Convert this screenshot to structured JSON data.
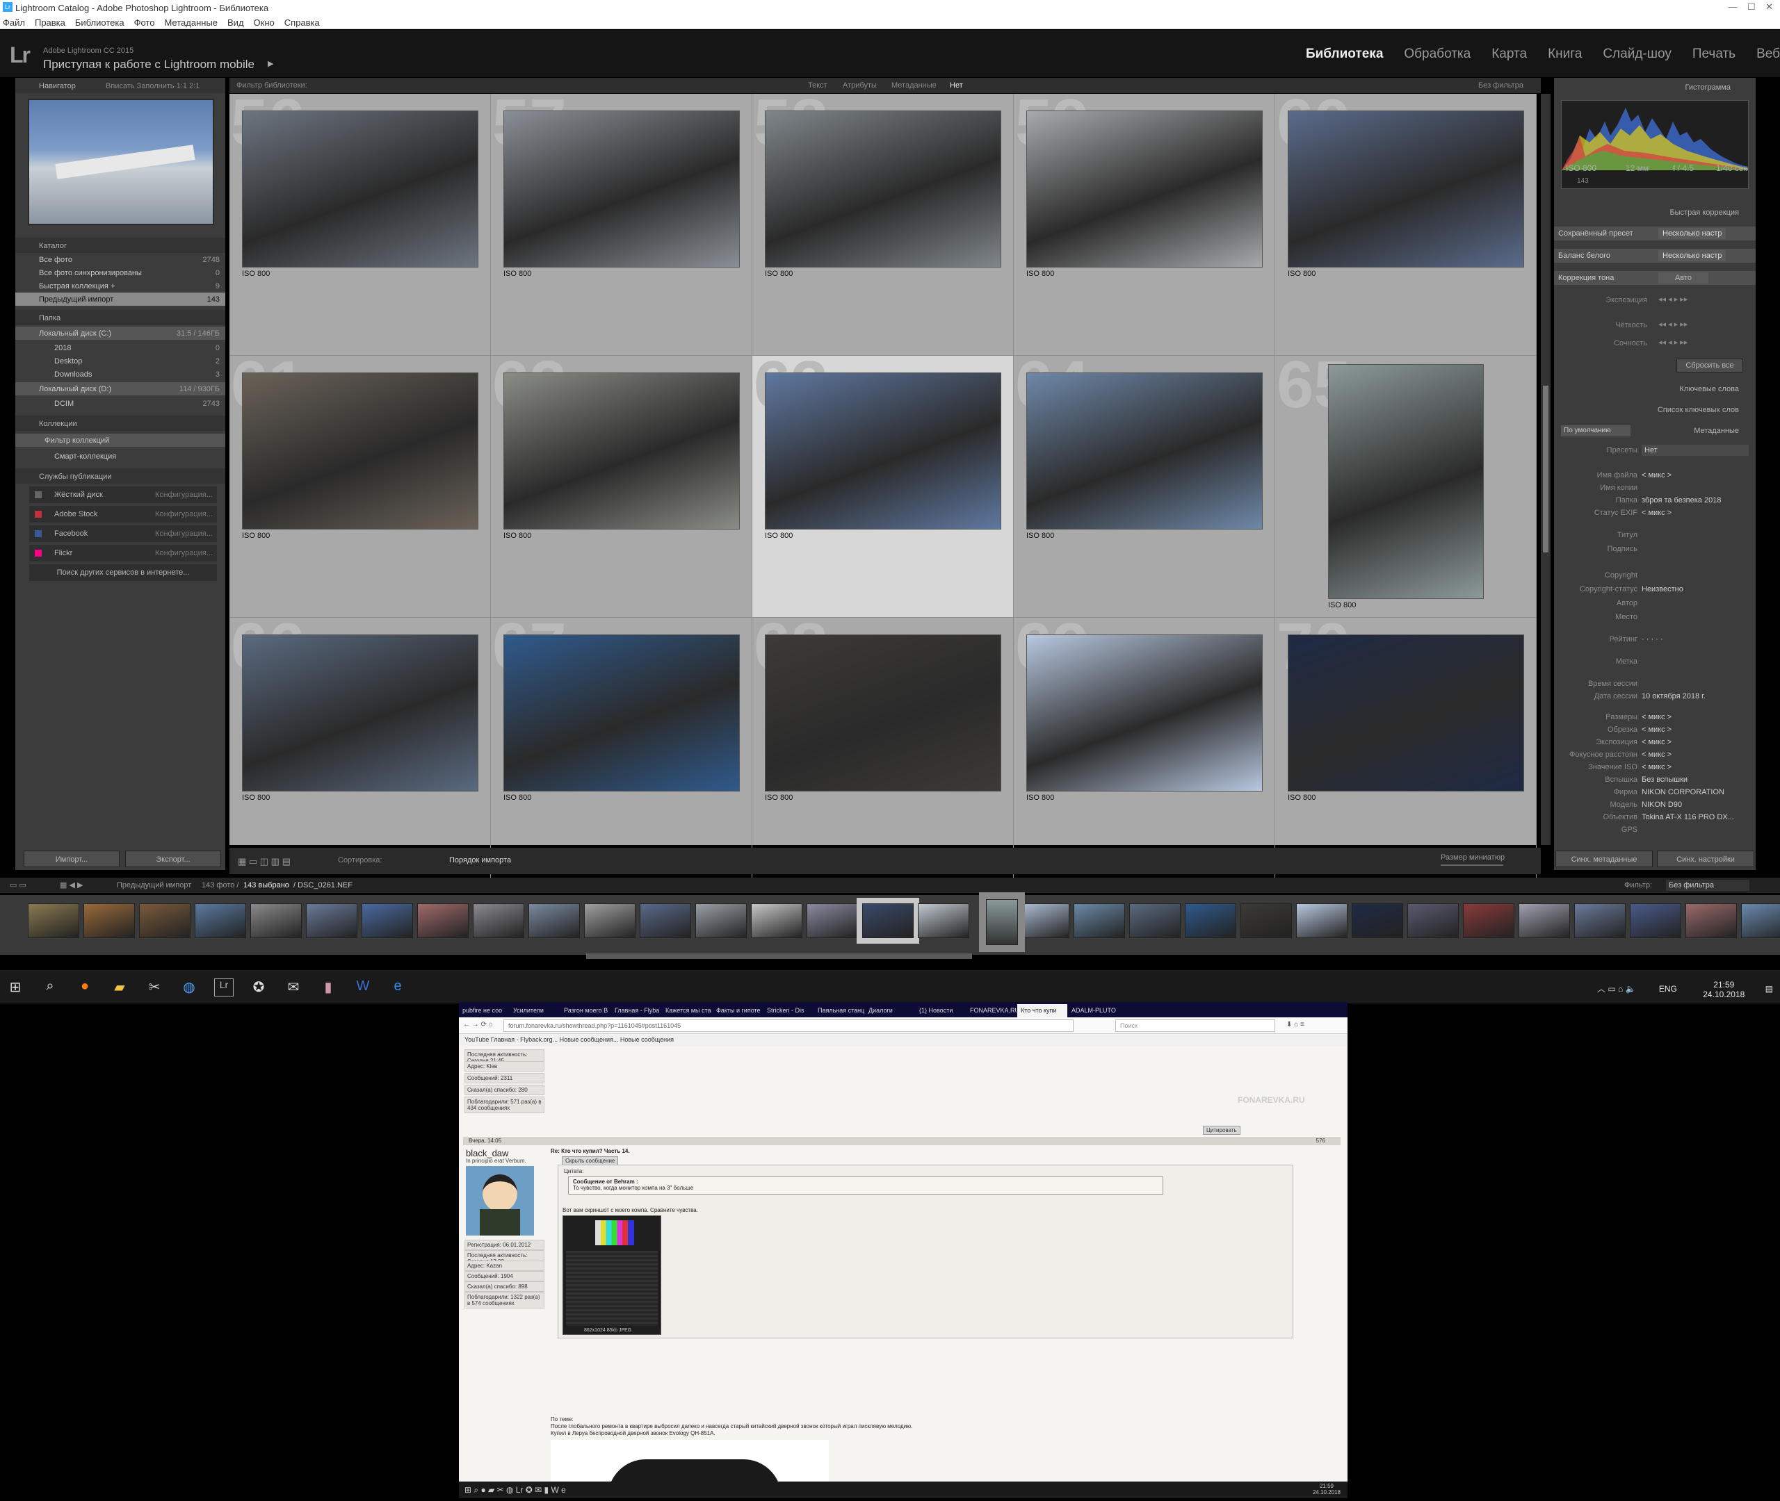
{
  "window": {
    "title": "Lightroom Catalog - Adobe Photoshop Lightroom - Библиотека"
  },
  "menu": [
    "Файл",
    "Правка",
    "Библиотека",
    "Фото",
    "Метаданные",
    "Вид",
    "Окно",
    "Справка"
  ],
  "identity": {
    "logo": "Lr",
    "version": "Adobe Lightroom CC 2015",
    "mobile": "Приступая к работе с Lightroom mobile"
  },
  "modules": [
    "Библиотека",
    "Обработка",
    "Карта",
    "Книга",
    "Слайд-шоу",
    "Печать",
    "Веб"
  ],
  "navigator": {
    "title": "Навигатор",
    "modes": "Вписать   Заполнить   1:1   2:1"
  },
  "catalog": {
    "title": "Каталог",
    "items": [
      {
        "label": "Все фото",
        "count": "2748"
      },
      {
        "label": "Все фото синхронизированы",
        "count": "0"
      },
      {
        "label": "Быстрая коллекция +",
        "count": "9"
      },
      {
        "label": "Предыдущий импорт",
        "count": "143"
      }
    ]
  },
  "folders": {
    "title": "Папка",
    "disk_c": "Локальный диск (C:)",
    "disk_c_size": "31.5 / 146ГБ",
    "items": [
      {
        "label": "2018",
        "count": "0"
      },
      {
        "label": "Desktop",
        "count": "2"
      },
      {
        "label": "Downloads",
        "count": "3"
      }
    ],
    "disk_d": "Локальный диск (D:)",
    "disk_d_size": "114 / 930ГБ",
    "dcim": "DCIM",
    "dcim_count": "2743"
  },
  "collections": {
    "title": "Коллекции",
    "filter": "Фильтр коллекций",
    "smart": "Смарт-коллекция"
  },
  "publish": {
    "title": "Службы публикации",
    "items": [
      {
        "label": "Жёсткий диск",
        "cfg": "Конфигурация..."
      },
      {
        "label": "Adobe Stock",
        "cfg": "Конфигурация..."
      },
      {
        "label": "Facebook",
        "cfg": "Конфигурация..."
      },
      {
        "label": "Flickr",
        "cfg": "Конфигурация..."
      }
    ],
    "more": "Поиск других сервисов в интернете..."
  },
  "buttons": {
    "import": "Импорт...",
    "export": "Экспорт...",
    "sync_meta": "Синх. метаданные",
    "sync_set": "Синх. настройки"
  },
  "filter_bar": {
    "label": "Фильтр библиотеки:",
    "text": "Текст",
    "attr": "Атрибуты",
    "meta": "Метаданные",
    "none": "Нет",
    "preset": "Без фильтра"
  },
  "grid": [
    {
      "num": "56",
      "iso": "ISO 800",
      "color": "#6d7580"
    },
    {
      "num": "57",
      "iso": "ISO 800",
      "color": "#8a8f96"
    },
    {
      "num": "58",
      "iso": "ISO 800",
      "color": "#7f868a"
    },
    {
      "num": "59",
      "iso": "ISO 800",
      "color": "#a7a9ab"
    },
    {
      "num": "60",
      "iso": "ISO 800",
      "color": "#5a6b8a"
    },
    {
      "num": "61",
      "iso": "ISO 800",
      "color": "#6a6258"
    },
    {
      "num": "62",
      "iso": "ISO 800",
      "color": "#8a8c86"
    },
    {
      "num": "63",
      "iso": "ISO 800",
      "color": "#5f78a0"
    },
    {
      "num": "64",
      "iso": "ISO 800",
      "color": "#6e88a8"
    },
    {
      "num": "65",
      "iso": "ISO 800",
      "color": "#8c9a98"
    },
    {
      "num": "66",
      "iso": "ISO 800",
      "color": "#5a6a80"
    },
    {
      "num": "67",
      "iso": "ISO 800",
      "color": "#2f5a8c"
    },
    {
      "num": "68",
      "iso": "ISO 800",
      "color": "#3c3a36"
    },
    {
      "num": "69",
      "iso": "ISO 800",
      "color": "#b8c8e0"
    },
    {
      "num": "70",
      "iso": "ISO 800",
      "color": "#1e2a44"
    }
  ],
  "toolbar": {
    "sort_label": "Сортировка:",
    "sort_value": "Порядок импорта",
    "thumb_size": "Размер миниатюр"
  },
  "filmstrip": {
    "source": "Предыдущий импорт",
    "count": "143 фото /",
    "selected": "143 выбрано",
    "file": "/ DSC_0261.NEF",
    "filter_label": "Фильтр:",
    "filter_value": "Без фильтра"
  },
  "histogram": {
    "title": "Гистограмма",
    "iso": "ISO 800",
    "focal": "12 мм",
    "aperture": "f / 4.5",
    "shutter": "1/40 сек",
    "count": "143"
  },
  "quick": {
    "title": "Быстрая коррекция",
    "preset_label": "Сохранённый пресет",
    "preset_value": "Несколько настр",
    "wb_label": "Баланс белого",
    "wb_value": "Несколько настр",
    "tone_label": "Коррекция тона",
    "tone_btn": "Авто",
    "exposure": "Экспозиция",
    "clarity": "Чёткость",
    "vibrance": "Сочность",
    "reset": "Сбросить все"
  },
  "keywords": {
    "title": "Ключевые слова",
    "list": "Список ключевых слов"
  },
  "metadata": {
    "title": "Метаданные",
    "mode": "По умолчанию",
    "preset_label": "Пресеты",
    "preset_value": "Нет",
    "fields": [
      {
        "k": "Имя файла",
        "v": "< микс >"
      },
      {
        "k": "Имя копии",
        "v": ""
      },
      {
        "k": "Папка",
        "v": "зброя та безпека 2018"
      },
      {
        "k": "Статус EXIF",
        "v": "< микс >"
      },
      {
        "k": "Титул",
        "v": ""
      },
      {
        "k": "Подпись",
        "v": ""
      },
      {
        "k": "Copyright",
        "v": ""
      },
      {
        "k": "Copyright-статус",
        "v": "Неизвестно"
      },
      {
        "k": "Автор",
        "v": ""
      },
      {
        "k": "Место",
        "v": ""
      },
      {
        "k": "Рейтинг",
        "v": "· · · · ·"
      },
      {
        "k": "Метка",
        "v": ""
      },
      {
        "k": "Время сессии",
        "v": ""
      },
      {
        "k": "Дата сессии",
        "v": "10 октября 2018 г."
      },
      {
        "k": "Размеры",
        "v": "< микс >"
      },
      {
        "k": "Обрезка",
        "v": "< микс >"
      },
      {
        "k": "Экспозиция",
        "v": "< микс >"
      },
      {
        "k": "Фокусное расстоян",
        "v": "< микс >"
      },
      {
        "k": "Значение ISO",
        "v": "< микс >"
      },
      {
        "k": "Вспышка",
        "v": "Без вспышки"
      },
      {
        "k": "Фирма",
        "v": "NIKON CORPORATION"
      },
      {
        "k": "Модель",
        "v": "NIKON D90"
      },
      {
        "k": "Объектив",
        "v": "Tokina AT-X 116 PRO DX..."
      },
      {
        "k": "GPS",
        "v": ""
      }
    ]
  },
  "tray": {
    "lang": "ENG",
    "time": "21:59",
    "date": "24.10.2018"
  },
  "browser": {
    "tabs": [
      "pubfire не соо",
      "Усилители",
      "Разгон моего В",
      "Главная - Flyba",
      "Кажется мы ста",
      "Факты и гипоте",
      "Stricken - Dis",
      "Паяльная станц",
      "Диалоги",
      "(1) Новости",
      "FONAREVKA.RU",
      "Кто что купи",
      "ADALM-PLUTO"
    ],
    "url": "forum.fonarevka.ru/showthread.php?p=1161045#post1161045",
    "search": "Поиск",
    "bookmarks": "YouTube   Главная - Flyback.org...   Новые сообщения...   Новые сообщения",
    "prev_user": [
      "Последняя активность: Сегодня 21:45",
      "Адрес: Kiев",
      "Сообщений: 2311",
      "Сказал(а) спасибо: 280",
      "Поблагодарили: 571 раз(а) в 434 сообщениях"
    ],
    "quote_btn": "Цитировать",
    "post_date": "Вчера, 14:05",
    "post_title": "Re: Кто что купил? Часть 14.",
    "post_num": "576",
    "user": "black_daw",
    "motto": "In principio erat Verbum.",
    "user_info": [
      "Регистрация: 06.01.2012",
      "Последняя активность: Сегодня 17:22",
      "Адрес: Kazan",
      "Сообщений: 1904",
      "Сказал(а) спасибо: 898",
      "Поблагодарили: 1322 раз(а) в 574 сообщениях"
    ],
    "hide": "Скрыть сообщение",
    "quote_label": "Цитата:",
    "quote_from": "Сообщение от Behram :",
    "quote_text": "То чувство, когда монитор компа на 3\" больше",
    "post_text": "Вот вам скриншот с моего компа. Сравните чувства.",
    "img_caption": "862x1024  85kb  JPEG",
    "topic_label": "По теме:",
    "topic_text": "После глобального ремонта в квартире выбросил далеко и навсегда старый китайский дверной звонок который играл писклявую мелодию.",
    "topic_text2": "Купил в Леруа беспроводной дверной звонок Evology QH-851A.",
    "watermark": "FONAREVKA.RU"
  }
}
